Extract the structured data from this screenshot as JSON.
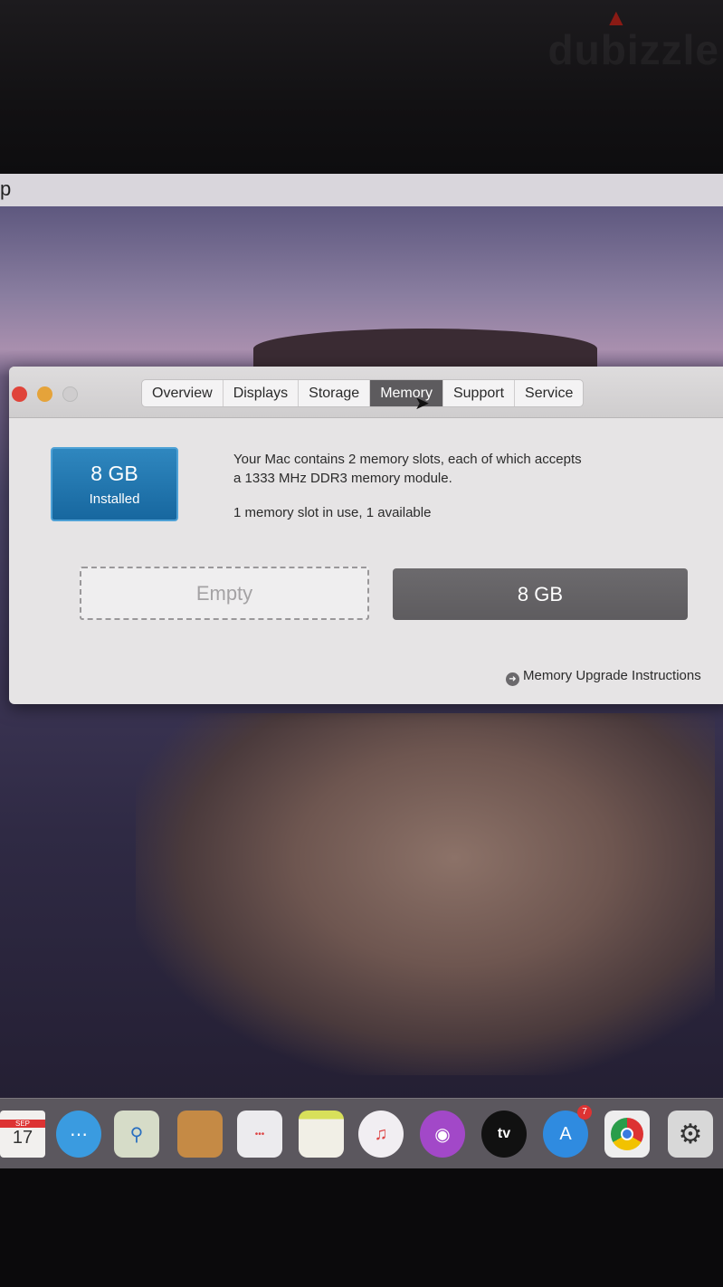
{
  "watermark": "dubizzle",
  "menubar": {
    "fragment": "p"
  },
  "window": {
    "tabs": [
      {
        "label": "Overview",
        "active": false
      },
      {
        "label": "Displays",
        "active": false
      },
      {
        "label": "Storage",
        "active": false
      },
      {
        "label": "Memory",
        "active": true
      },
      {
        "label": "Support",
        "active": false
      },
      {
        "label": "Service",
        "active": false
      }
    ],
    "memory": {
      "installed_amount": "8 GB",
      "installed_label": "Installed",
      "description_line1": "Your Mac contains 2 memory slots, each of which accepts",
      "description_line2": "a 1333 MHz DDR3 memory module.",
      "usage": "1 memory slot in use, 1 available",
      "slots": [
        {
          "label": "Empty"
        },
        {
          "label": "8 GB"
        }
      ],
      "upgrade_link": "Memory Upgrade Instructions"
    },
    "colors": {
      "close": "#e0443a",
      "minimize": "#e5a33a",
      "badge": "#1f78b2"
    }
  },
  "dock": {
    "calendar_month": "SEP",
    "calendar_day": "17",
    "appletv_label": "tv",
    "appstore_badge": "7",
    "icons": [
      "calendar-icon",
      "messages-icon",
      "maps-icon",
      "contacts-icon",
      "reminders-icon",
      "notes-icon",
      "music-icon",
      "podcasts-icon",
      "apple-tv-icon",
      "app-store-icon",
      "chrome-icon",
      "system-preferences-icon"
    ]
  }
}
